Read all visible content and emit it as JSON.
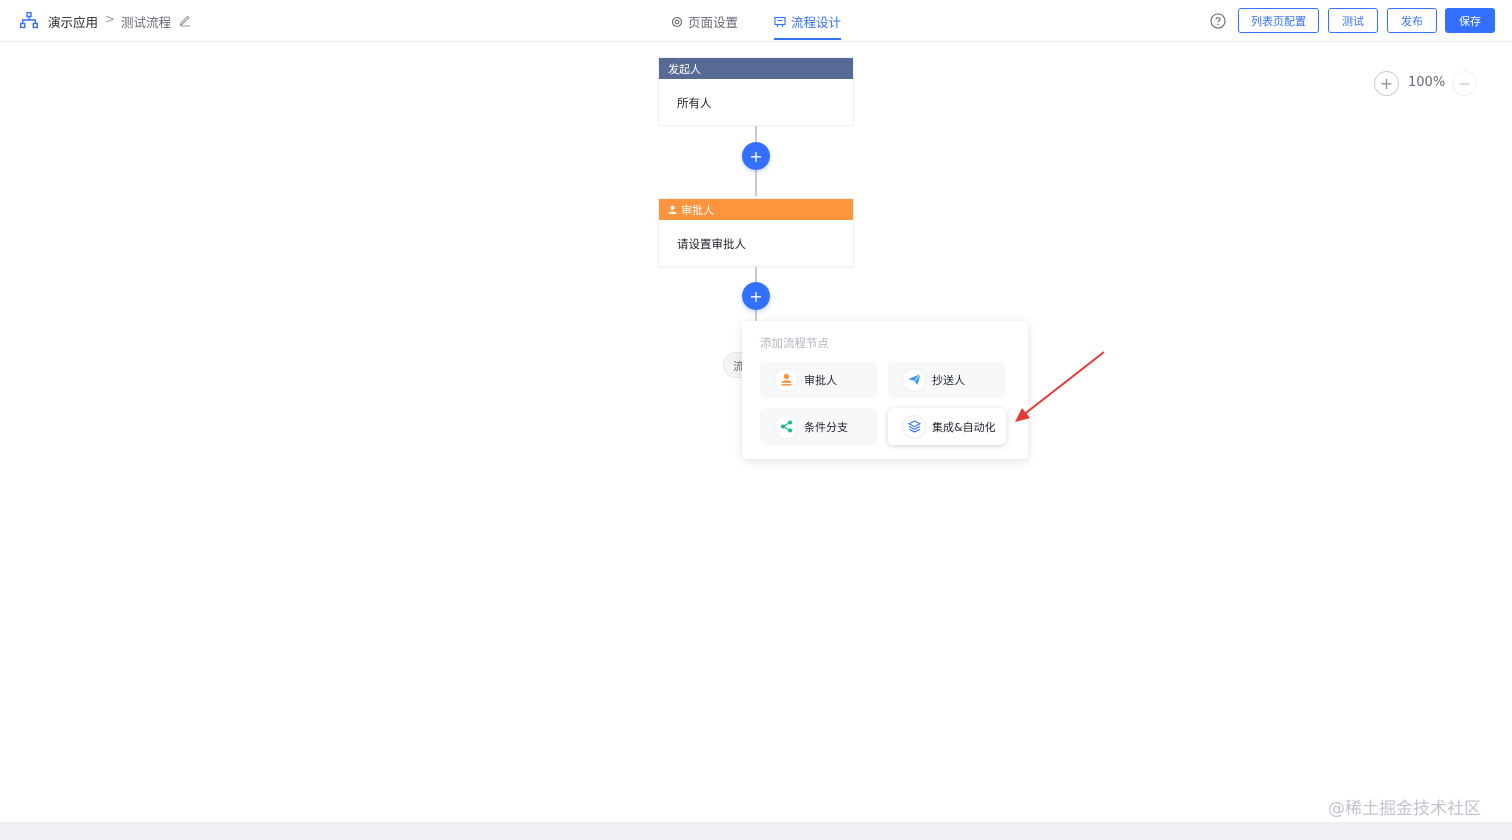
{
  "header": {
    "app_name": "演示应用",
    "separator": ">",
    "flow_name": "测试流程",
    "tabs": [
      {
        "label": "页面设置",
        "active": false
      },
      {
        "label": "流程设计",
        "active": true
      }
    ],
    "buttons": {
      "list_config": "列表页配置",
      "test": "测试",
      "publish": "发布",
      "save": "保存"
    }
  },
  "zoom": {
    "level": "100%",
    "in_symbol": "+",
    "out_symbol": "−"
  },
  "flow": {
    "start_node": {
      "title": "发起人",
      "content": "所有人"
    },
    "approver_node": {
      "title": "审批人",
      "content": "请设置审批人"
    },
    "add_symbol": "+",
    "end_stub": "流"
  },
  "popover": {
    "title": "添加流程节点",
    "items": [
      {
        "label": "审批人",
        "icon": "approver-icon"
      },
      {
        "label": "抄送人",
        "icon": "send-icon"
      },
      {
        "label": "条件分支",
        "icon": "share-icon"
      },
      {
        "label": "集成&自动化",
        "icon": "layers-icon"
      }
    ]
  },
  "watermark": "@稀土掘金技术社区",
  "colors": {
    "accent": "#3370ff",
    "start_node": "#576a95",
    "approver_node": "#ff943e",
    "arrow": "#e53935"
  }
}
